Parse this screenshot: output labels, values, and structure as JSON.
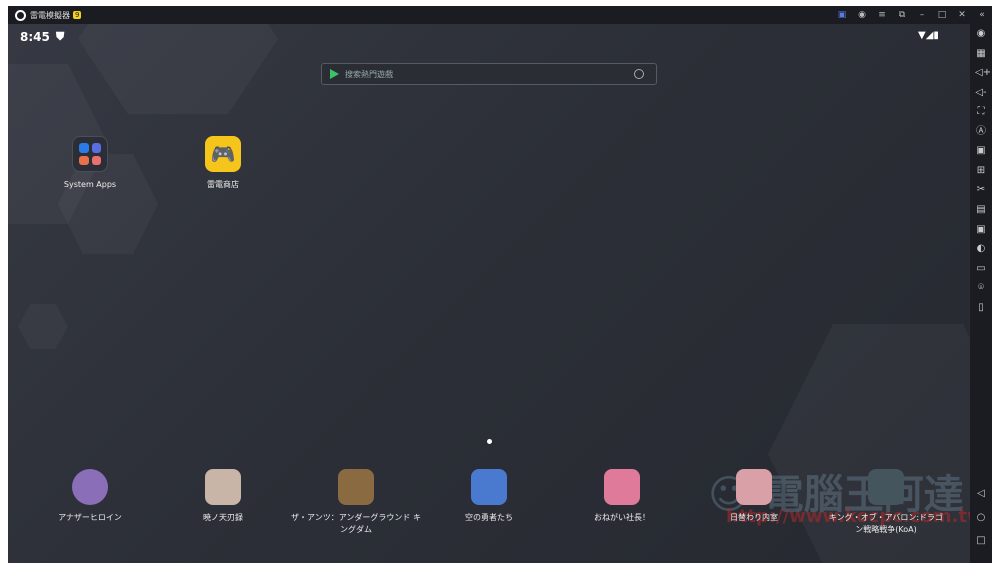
{
  "titlebar": {
    "title": "雷電模擬器",
    "badge": "9",
    "icons": [
      "gamepad-icon",
      "account-icon",
      "menu-icon",
      "resize-icon",
      "minimize-icon",
      "maximize-icon",
      "close-icon",
      "collapse-icon"
    ]
  },
  "status": {
    "time": "8:45"
  },
  "search": {
    "placeholder": "搜索熱門遊戲"
  },
  "desktop": [
    {
      "label": "System Apps"
    },
    {
      "label": "雷電商店"
    }
  ],
  "dock": [
    {
      "label": "アナザーヒロイン",
      "color": "#8a6fb8"
    },
    {
      "label": "暁ノ天刃録",
      "color": "#c9b4a8"
    },
    {
      "label": "ザ・アンツ：アンダーグラウンド キングダム",
      "color": "#8a6a40"
    },
    {
      "label": "空の勇者たち",
      "color": "#4a7ad0"
    },
    {
      "label": "おねがい社長！",
      "color": "#e07a9a"
    },
    {
      "label": "日替わり内室",
      "color": "#d9a0a8"
    },
    {
      "label": "キング・オブ・アバロン:ドラゴン戦略戦争(KoA)",
      "color": "#44555e"
    }
  ],
  "watermark": {
    "title": "電腦王阿達",
    "url": "http://www.kocpc.com.tw"
  },
  "sidebar": [
    "settings",
    "keyboard",
    "volume-up",
    "volume-down",
    "fullscreen",
    "auto-click",
    "screenshot",
    "install-apk",
    "scissors",
    "record",
    "operations",
    "rotate",
    "folder",
    "location",
    "shake"
  ],
  "nav": [
    "◁",
    "○",
    "□"
  ]
}
